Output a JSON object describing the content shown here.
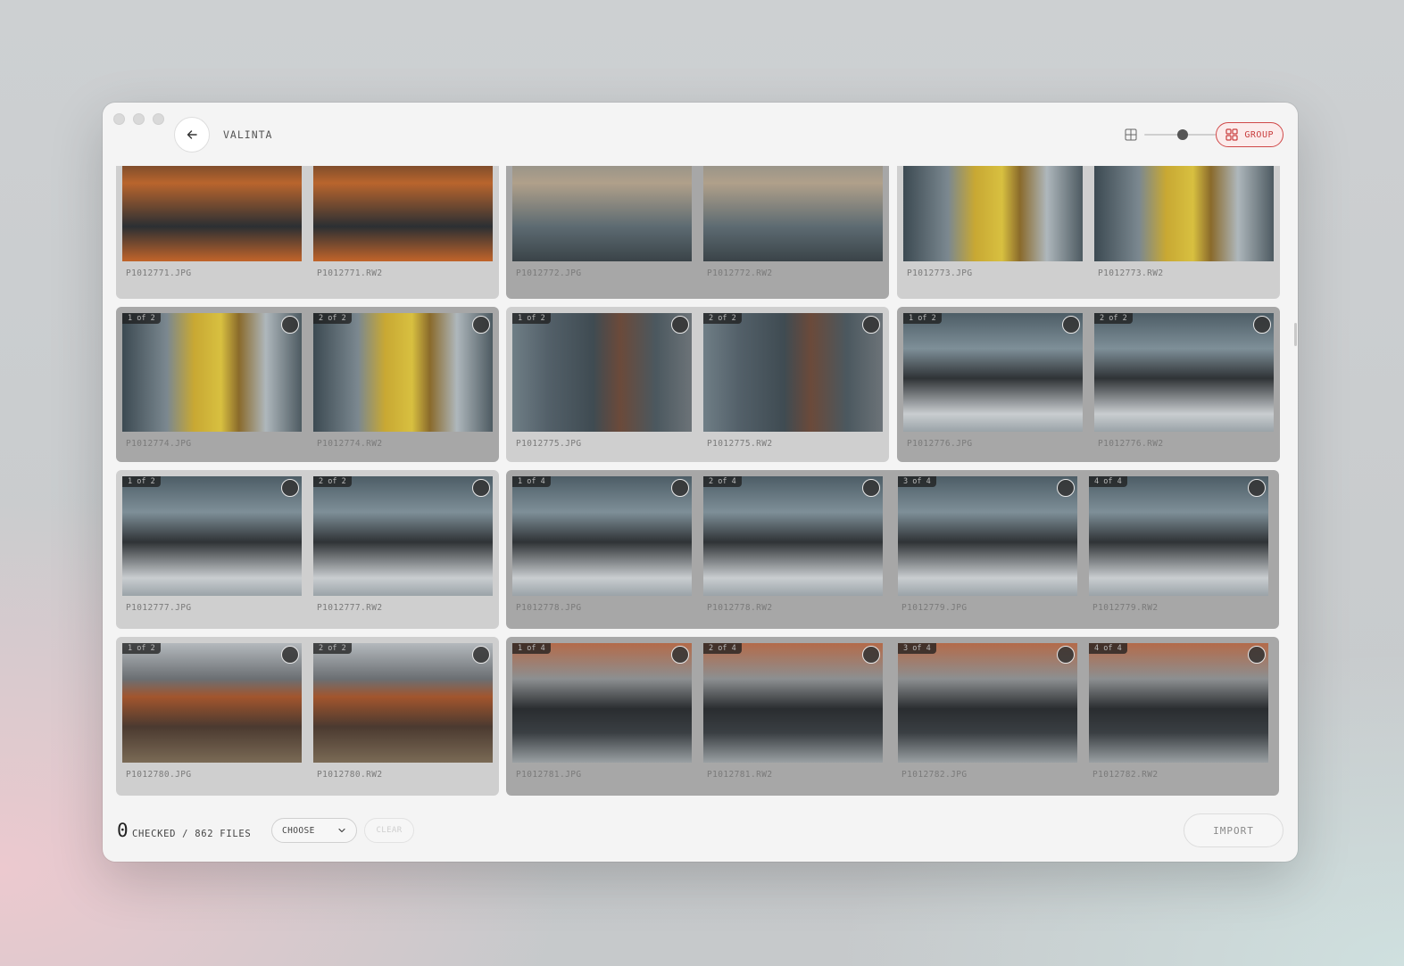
{
  "header": {
    "title": "VALINTA",
    "zoom_level": 0.55,
    "group_label": "GROUP"
  },
  "icons": {
    "back": "arrow-left-icon",
    "grid": "grid-icon",
    "group": "group-grid-icon",
    "chevron": "chevron-down-icon"
  },
  "colors": {
    "accent": "#d04848",
    "group_bg_light": "#cfcfcf",
    "group_bg_dark": "#a7a7a7"
  },
  "grid": {
    "rows": [
      {
        "groups": [
          {
            "tone": "light",
            "items": [
              {
                "file": "P1012771.JPG",
                "badge": "",
                "scene": "turntable"
              },
              {
                "file": "P1012771.RW2",
                "badge": "",
                "scene": "turntable"
              }
            ]
          },
          {
            "tone": "dark",
            "items": [
              {
                "file": "P1012772.JPG",
                "badge": "",
                "scene": "shelves"
              },
              {
                "file": "P1012772.RW2",
                "badge": "",
                "scene": "shelves"
              }
            ]
          },
          {
            "tone": "light",
            "items": [
              {
                "file": "P1012773.JPG",
                "badge": "",
                "scene": "yellow"
              },
              {
                "file": "P1012773.RW2",
                "badge": "",
                "scene": "yellow"
              }
            ]
          }
        ]
      },
      {
        "groups": [
          {
            "tone": "dark",
            "items": [
              {
                "file": "P1012774.JPG",
                "badge": "1 of 2",
                "scene": "yellow"
              },
              {
                "file": "P1012774.RW2",
                "badge": "2 of 2",
                "scene": "yellow"
              }
            ]
          },
          {
            "tone": "light",
            "items": [
              {
                "file": "P1012775.JPG",
                "badge": "1 of 2",
                "scene": "records"
              },
              {
                "file": "P1012775.RW2",
                "badge": "2 of 2",
                "scene": "records"
              }
            ]
          },
          {
            "tone": "dark",
            "items": [
              {
                "file": "P1012776.JPG",
                "badge": "1 of 2",
                "scene": "aisle"
              },
              {
                "file": "P1012776.RW2",
                "badge": "2 of 2",
                "scene": "aisle"
              }
            ]
          }
        ]
      },
      {
        "groups": [
          {
            "tone": "light",
            "items": [
              {
                "file": "P1012777.JPG",
                "badge": "1 of 2",
                "scene": "aisle"
              },
              {
                "file": "P1012777.RW2",
                "badge": "2 of 2",
                "scene": "aisle"
              }
            ]
          },
          {
            "tone": "dark",
            "items": [
              {
                "file": "P1012778.JPG",
                "badge": "1 of 4",
                "scene": "aisle"
              },
              {
                "file": "P1012778.RW2",
                "badge": "2 of 4",
                "scene": "aisle"
              },
              {
                "file": "P1012779.JPG",
                "badge": "3 of 4",
                "scene": "aisle"
              },
              {
                "file": "P1012779.RW2",
                "badge": "4 of 4",
                "scene": "aisle"
              }
            ]
          }
        ]
      },
      {
        "groups": [
          {
            "tone": "light",
            "items": [
              {
                "file": "P1012780.JPG",
                "badge": "1 of 2",
                "scene": "street"
              },
              {
                "file": "P1012780.RW2",
                "badge": "2 of 2",
                "scene": "street"
              }
            ]
          },
          {
            "tone": "dark",
            "items": [
              {
                "file": "P1012781.JPG",
                "badge": "1 of 4",
                "scene": "camera"
              },
              {
                "file": "P1012781.RW2",
                "badge": "2 of 4",
                "scene": "camera"
              },
              {
                "file": "P1012782.JPG",
                "badge": "3 of 4",
                "scene": "camera"
              },
              {
                "file": "P1012782.RW2",
                "badge": "4 of 4",
                "scene": "camera"
              }
            ]
          }
        ]
      }
    ]
  },
  "footer": {
    "checked_count": "0",
    "checked_label": "CHECKED / 862 FILES",
    "choose_label": "CHOOSE",
    "clear_label": "CLEAR",
    "import_label": "IMPORT"
  }
}
